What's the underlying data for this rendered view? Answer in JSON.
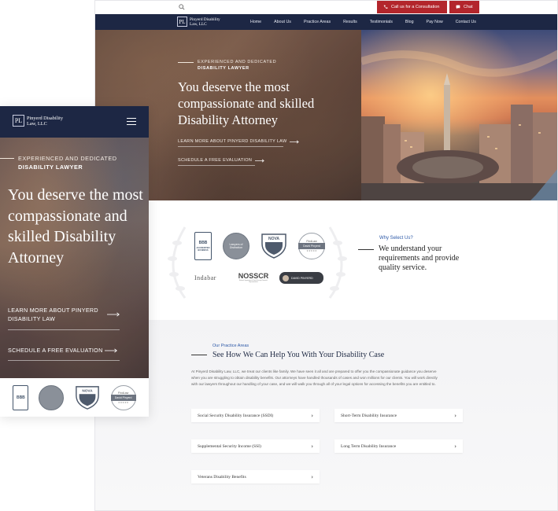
{
  "desktop": {
    "topbar": {
      "consult_label": "Call us for a Consultation",
      "chat_label": "Chat"
    },
    "brand": {
      "monogram": "PL",
      "name_line1": "Pinyerd Disability",
      "name_line2": "Law, LLC"
    },
    "nav": [
      "Home",
      "About Us",
      "Practice Areas",
      "Results",
      "Testimonials",
      "Blog",
      "Pay Now",
      "Contact Us"
    ],
    "hero": {
      "eyebrow": "EXPERIENCED AND DEDICATED",
      "eyebrow_bold": "DISABILITY LAWYER",
      "title": "You deserve the most compassionate and skilled Disability Attorney",
      "link_learn": "LEARN MORE ABOUT PINYERD DISABILITY LAW",
      "link_schedule": "SCHEDULE A FREE EVALUATION"
    },
    "why": {
      "label": "Why Select Us?",
      "title": "We understand your requirements and provide quality service.",
      "badges": {
        "bbb": "BBB",
        "bbb_sub": "ACCREDITED BUSINESS",
        "seal": "Lawyers of Distinction",
        "nova": "NOVA",
        "avvo_top": "FindLaw",
        "avvo_band": "David Pinyerd",
        "indabar": "Indabar",
        "nosscr": "NOSSCR",
        "nosscr_sub": "National Organization of Social Security Claimants' Representatives",
        "david": "DAVID PINYERD"
      }
    },
    "practice": {
      "label": "Our Practice Areas",
      "title": "See How We Can Help You With Your Disability Case",
      "body": "At Pinyerd Disability Law, LLC, we treat our clients like family. We have seen it all and are prepared to offer you the compassionate guidance you deserve when you are struggling to obtain disability benefits. Our attorneys have handled thousands of cases and won millions for our clients. You will work directly with our lawyers throughout our handling of your case, and we will walk you through all of your legal options for accessing the benefits you are entitled to.",
      "areas": [
        "Social Security Disability Insurance (SSDI)",
        "Short-Term Disability Insurance",
        "Supplemental Security Income (SSI)",
        "Long Term Disability Insurance",
        "Veterans Disability Benefits"
      ]
    }
  },
  "mobile": {
    "brand_line1": "Pinyerd Disability",
    "brand_line2": "Law, LLC",
    "eyebrow": "EXPERIENCED AND DEDICATED",
    "eyebrow_bold": "DISABILITY LAWYER",
    "title": "You deserve the most compassionate and skilled Disability Attorney",
    "link_learn": "LEARN MORE ABOUT PINYERD DISABILITY LAW",
    "link_schedule": "SCHEDULE A FREE EVALUATION"
  },
  "colors": {
    "navy": "#1d2744",
    "red": "#b3262c",
    "accent_blue": "#2e5aa8"
  },
  "icons": [
    "search-icon",
    "phone-icon",
    "chat-icon",
    "arrow-right-icon",
    "chevron-right-icon",
    "menu-icon"
  ]
}
